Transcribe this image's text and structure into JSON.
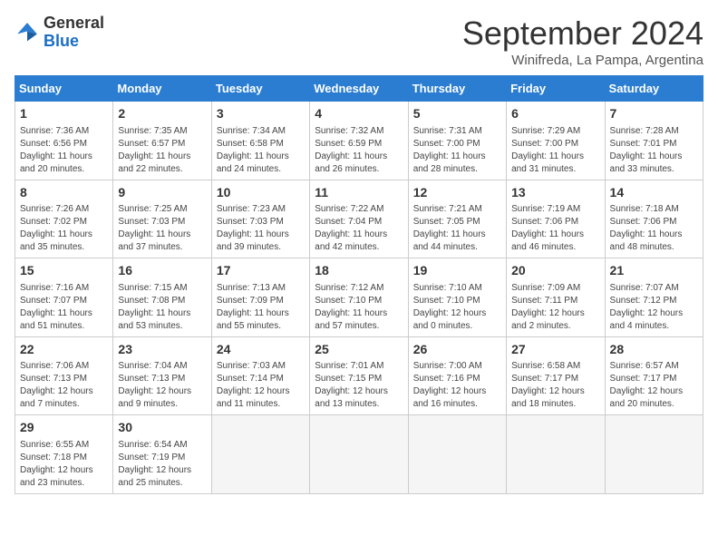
{
  "logo": {
    "general": "General",
    "blue": "Blue"
  },
  "title": "September 2024",
  "subtitle": "Winifreda, La Pampa, Argentina",
  "weekdays": [
    "Sunday",
    "Monday",
    "Tuesday",
    "Wednesday",
    "Thursday",
    "Friday",
    "Saturday"
  ],
  "weeks": [
    [
      {
        "day": "1",
        "info": "Sunrise: 7:36 AM\nSunset: 6:56 PM\nDaylight: 11 hours\nand 20 minutes."
      },
      {
        "day": "2",
        "info": "Sunrise: 7:35 AM\nSunset: 6:57 PM\nDaylight: 11 hours\nand 22 minutes."
      },
      {
        "day": "3",
        "info": "Sunrise: 7:34 AM\nSunset: 6:58 PM\nDaylight: 11 hours\nand 24 minutes."
      },
      {
        "day": "4",
        "info": "Sunrise: 7:32 AM\nSunset: 6:59 PM\nDaylight: 11 hours\nand 26 minutes."
      },
      {
        "day": "5",
        "info": "Sunrise: 7:31 AM\nSunset: 7:00 PM\nDaylight: 11 hours\nand 28 minutes."
      },
      {
        "day": "6",
        "info": "Sunrise: 7:29 AM\nSunset: 7:00 PM\nDaylight: 11 hours\nand 31 minutes."
      },
      {
        "day": "7",
        "info": "Sunrise: 7:28 AM\nSunset: 7:01 PM\nDaylight: 11 hours\nand 33 minutes."
      }
    ],
    [
      {
        "day": "8",
        "info": "Sunrise: 7:26 AM\nSunset: 7:02 PM\nDaylight: 11 hours\nand 35 minutes."
      },
      {
        "day": "9",
        "info": "Sunrise: 7:25 AM\nSunset: 7:03 PM\nDaylight: 11 hours\nand 37 minutes."
      },
      {
        "day": "10",
        "info": "Sunrise: 7:23 AM\nSunset: 7:03 PM\nDaylight: 11 hours\nand 39 minutes."
      },
      {
        "day": "11",
        "info": "Sunrise: 7:22 AM\nSunset: 7:04 PM\nDaylight: 11 hours\nand 42 minutes."
      },
      {
        "day": "12",
        "info": "Sunrise: 7:21 AM\nSunset: 7:05 PM\nDaylight: 11 hours\nand 44 minutes."
      },
      {
        "day": "13",
        "info": "Sunrise: 7:19 AM\nSunset: 7:06 PM\nDaylight: 11 hours\nand 46 minutes."
      },
      {
        "day": "14",
        "info": "Sunrise: 7:18 AM\nSunset: 7:06 PM\nDaylight: 11 hours\nand 48 minutes."
      }
    ],
    [
      {
        "day": "15",
        "info": "Sunrise: 7:16 AM\nSunset: 7:07 PM\nDaylight: 11 hours\nand 51 minutes."
      },
      {
        "day": "16",
        "info": "Sunrise: 7:15 AM\nSunset: 7:08 PM\nDaylight: 11 hours\nand 53 minutes."
      },
      {
        "day": "17",
        "info": "Sunrise: 7:13 AM\nSunset: 7:09 PM\nDaylight: 11 hours\nand 55 minutes."
      },
      {
        "day": "18",
        "info": "Sunrise: 7:12 AM\nSunset: 7:10 PM\nDaylight: 11 hours\nand 57 minutes."
      },
      {
        "day": "19",
        "info": "Sunrise: 7:10 AM\nSunset: 7:10 PM\nDaylight: 12 hours\nand 0 minutes."
      },
      {
        "day": "20",
        "info": "Sunrise: 7:09 AM\nSunset: 7:11 PM\nDaylight: 12 hours\nand 2 minutes."
      },
      {
        "day": "21",
        "info": "Sunrise: 7:07 AM\nSunset: 7:12 PM\nDaylight: 12 hours\nand 4 minutes."
      }
    ],
    [
      {
        "day": "22",
        "info": "Sunrise: 7:06 AM\nSunset: 7:13 PM\nDaylight: 12 hours\nand 7 minutes."
      },
      {
        "day": "23",
        "info": "Sunrise: 7:04 AM\nSunset: 7:13 PM\nDaylight: 12 hours\nand 9 minutes."
      },
      {
        "day": "24",
        "info": "Sunrise: 7:03 AM\nSunset: 7:14 PM\nDaylight: 12 hours\nand 11 minutes."
      },
      {
        "day": "25",
        "info": "Sunrise: 7:01 AM\nSunset: 7:15 PM\nDaylight: 12 hours\nand 13 minutes."
      },
      {
        "day": "26",
        "info": "Sunrise: 7:00 AM\nSunset: 7:16 PM\nDaylight: 12 hours\nand 16 minutes."
      },
      {
        "day": "27",
        "info": "Sunrise: 6:58 AM\nSunset: 7:17 PM\nDaylight: 12 hours\nand 18 minutes."
      },
      {
        "day": "28",
        "info": "Sunrise: 6:57 AM\nSunset: 7:17 PM\nDaylight: 12 hours\nand 20 minutes."
      }
    ],
    [
      {
        "day": "29",
        "info": "Sunrise: 6:55 AM\nSunset: 7:18 PM\nDaylight: 12 hours\nand 23 minutes."
      },
      {
        "day": "30",
        "info": "Sunrise: 6:54 AM\nSunset: 7:19 PM\nDaylight: 12 hours\nand 25 minutes."
      },
      {
        "day": "",
        "info": ""
      },
      {
        "day": "",
        "info": ""
      },
      {
        "day": "",
        "info": ""
      },
      {
        "day": "",
        "info": ""
      },
      {
        "day": "",
        "info": ""
      }
    ]
  ]
}
